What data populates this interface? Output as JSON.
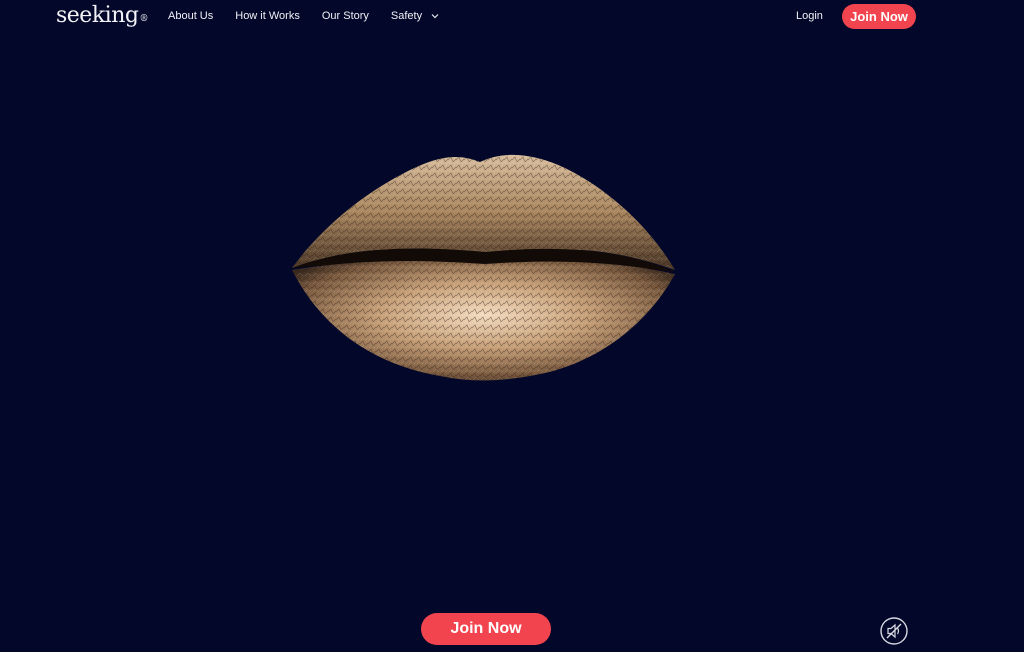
{
  "header": {
    "logo_text": "seeking",
    "logo_mark": "®",
    "nav": [
      {
        "label": "About Us"
      },
      {
        "label": "How it Works"
      },
      {
        "label": "Our Story"
      },
      {
        "label": "Safety",
        "icon": "chevron-down-icon"
      }
    ],
    "login_label": "Login",
    "join_label": "Join Now"
  },
  "hero": {
    "image": "gold-lips",
    "cta_label": "Join Now",
    "sound_icon": "muted-speaker-icon"
  },
  "colors": {
    "background": "#03082b",
    "accent": "#f2444e",
    "text": "#ffffff"
  }
}
